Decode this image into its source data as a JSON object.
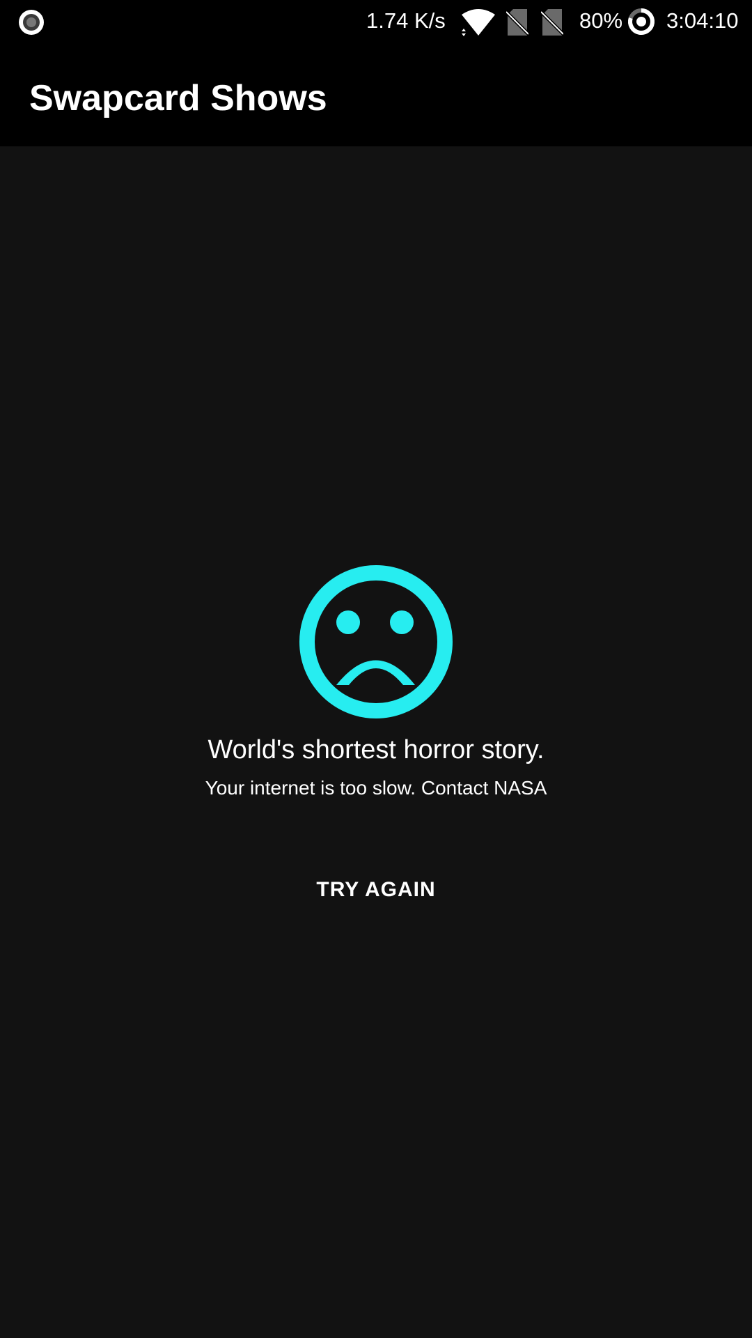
{
  "status_bar": {
    "net_speed": "1.74 K/s",
    "battery_percent": "80%",
    "time": "3:04:10",
    "icons": [
      "record-icon",
      "wifi-icon",
      "no-sim-icon",
      "no-sim-icon",
      "battery-ring-icon"
    ]
  },
  "app_bar": {
    "title": "Swapcard Shows"
  },
  "error": {
    "icon": "sad-face-icon",
    "title": "World's shortest horror story.",
    "message": "Your internet is too slow. Contact NASA",
    "retry_label": "TRY AGAIN"
  },
  "colors": {
    "accent": "#27EDF0",
    "background": "#121212",
    "bar": "#000000",
    "text": "#FFFFFF"
  }
}
